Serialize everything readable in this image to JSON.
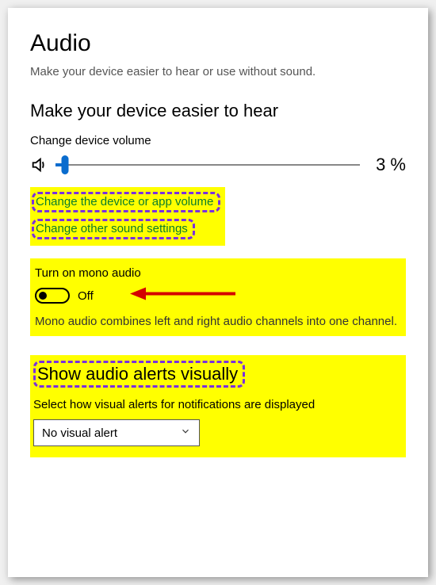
{
  "page": {
    "title": "Audio",
    "description": "Make your device easier to hear or use without sound."
  },
  "hear": {
    "section_title": "Make your device easier to hear",
    "volume_label": "Change device volume",
    "volume_percent_text": "3 %",
    "link_device_volume": "Change the device or app volume",
    "link_other_sound": "Change other sound settings"
  },
  "mono": {
    "title": "Turn on mono audio",
    "state": "Off",
    "description": "Mono audio combines left and right audio channels into one channel."
  },
  "visual": {
    "section_title": "Show audio alerts visually",
    "field_label": "Select how visual alerts for notifications are displayed",
    "selected": "No visual alert"
  }
}
